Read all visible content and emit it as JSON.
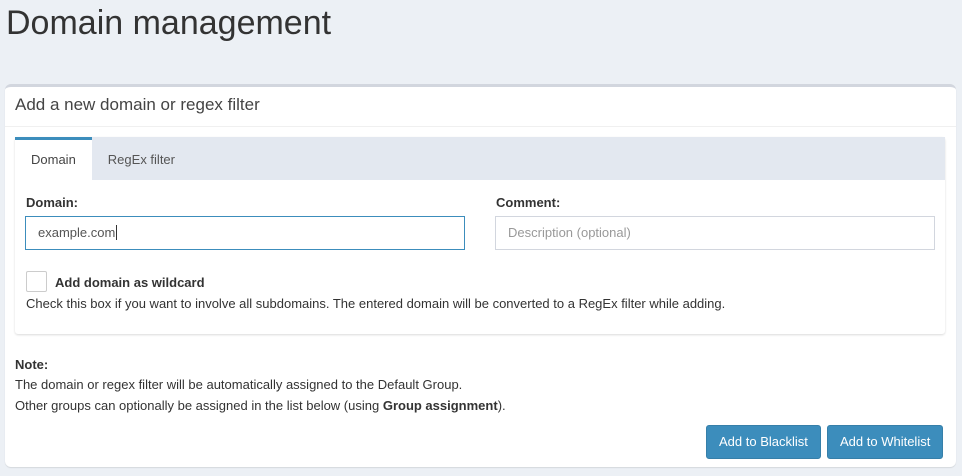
{
  "page_title": "Domain management",
  "card": {
    "title": "Add a new domain or regex filter"
  },
  "tabs": [
    {
      "label": "Domain"
    },
    {
      "label": "RegEx filter"
    }
  ],
  "form": {
    "domain_label": "Domain:",
    "domain_value": "example.com",
    "comment_label": "Comment:",
    "comment_placeholder": "Description (optional)",
    "wildcard_label": "Add domain as wildcard",
    "wildcard_help": "Check this box if you want to involve all subdomains. The entered domain will be converted to a RegEx filter while adding."
  },
  "note": {
    "title": "Note:",
    "line1": "The domain or regex filter will be automatically assigned to the Default Group.",
    "line2_pre": "Other groups can optionally be assigned in the list below (using ",
    "line2_bold": "Group assignment",
    "line2_post": ")."
  },
  "buttons": {
    "blacklist": "Add to Blacklist",
    "whitelist": "Add to Whitelist"
  },
  "colors": {
    "accent": "#3c8dbc",
    "background": "#ecf0f5"
  }
}
